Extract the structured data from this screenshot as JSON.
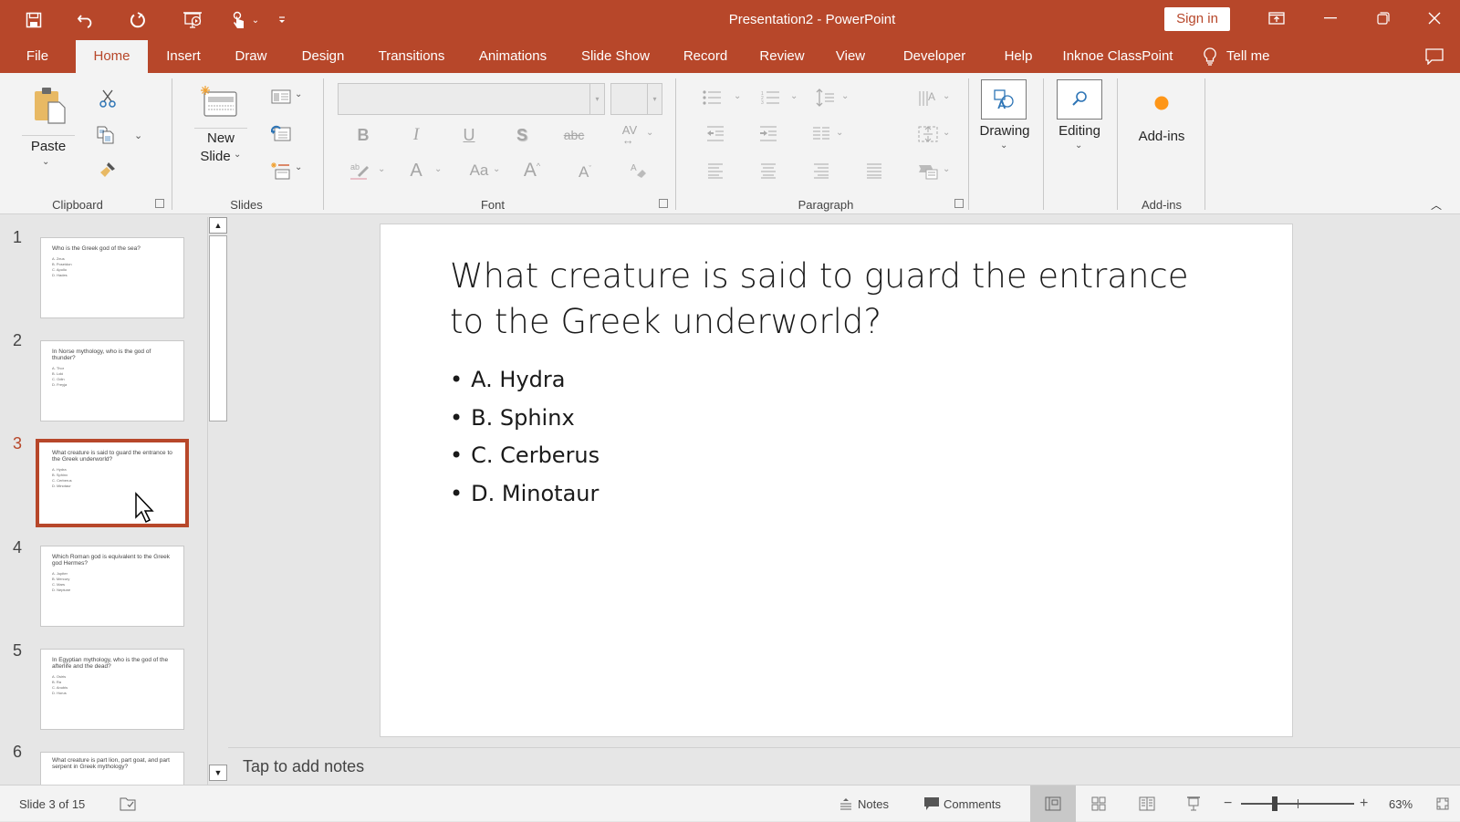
{
  "window": {
    "title": "Presentation2  -  PowerPoint",
    "sign_in": "Sign in",
    "accent": "#b7472a"
  },
  "qat": {
    "icons": [
      "save-icon",
      "undo-icon",
      "redo-icon",
      "present-from-start-icon",
      "touch-mode-icon",
      "customize-qat-icon"
    ]
  },
  "tabs": [
    "File",
    "Home",
    "Insert",
    "Draw",
    "Design",
    "Transitions",
    "Animations",
    "Slide Show",
    "Record",
    "Review",
    "View",
    "Developer",
    "Help",
    "Inknoe ClassPoint"
  ],
  "active_tab": "Home",
  "tell_me": "Tell me",
  "ribbon": {
    "clipboard": {
      "label": "Clipboard",
      "paste": "Paste"
    },
    "slides": {
      "label": "Slides",
      "new_slide_line1": "New",
      "new_slide_line2": "Slide"
    },
    "font": {
      "label": "Font",
      "font_name": "",
      "font_size": ""
    },
    "paragraph": {
      "label": "Paragraph"
    },
    "drawing": {
      "label": "Drawing"
    },
    "editing": {
      "label": "Editing"
    },
    "addins": {
      "button": "Add-ins",
      "label": "Add-ins"
    }
  },
  "thumbnails": [
    {
      "num": "1",
      "title": "Who is the Greek god of the sea?",
      "options": [
        "A. Zeus",
        "B. Poseidon",
        "C. Apollo",
        "D. Hades"
      ]
    },
    {
      "num": "2",
      "title": "In Norse mythology, who is the god of thunder?",
      "options": [
        "A. Thor",
        "B. Loki",
        "C. Odin",
        "D. Freyja"
      ]
    },
    {
      "num": "3",
      "title": "What creature is said to guard the entrance to the Greek underworld?",
      "options": [
        "A. Hydra",
        "B. Sphinx",
        "C. Cerberus",
        "D. Minotaur"
      ]
    },
    {
      "num": "4",
      "title": "Which Roman god is equivalent to the Greek god Hermes?",
      "options": [
        "A. Jupiter",
        "B. Mercury",
        "C. Mars",
        "D. Neptune"
      ]
    },
    {
      "num": "5",
      "title": "In Egyptian mythology, who is the god of the afterlife and the dead?",
      "options": [
        "A. Osiris",
        "B. Ra",
        "C. Anubis",
        "D. Horus"
      ]
    },
    {
      "num": "6",
      "title": "What creature is part lion, part goat, and part serpent in Greek mythology?",
      "options": []
    }
  ],
  "selected_slide": 3,
  "slide": {
    "title": "What creature is said to guard the entrance to the Greek underworld?",
    "options": [
      "A. Hydra",
      "B. Sphinx",
      "C. Cerberus",
      "D. Minotaur"
    ]
  },
  "notes_placeholder": "Tap to add notes",
  "status": {
    "slide_counter": "Slide 3 of 15",
    "notes": "Notes",
    "comments": "Comments",
    "zoom": "63%",
    "zoom_percent": 63
  }
}
